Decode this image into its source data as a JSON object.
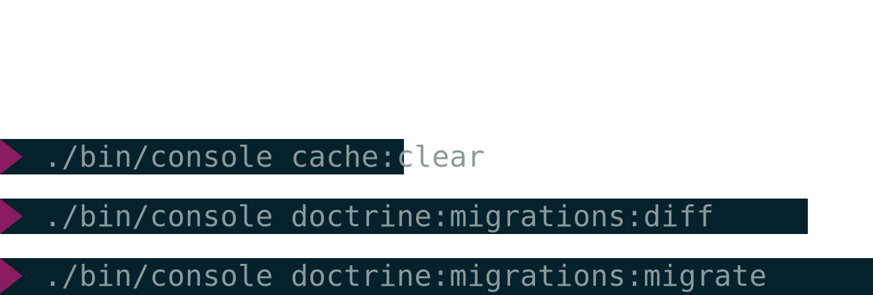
{
  "terminal": {
    "prompt_icon": "chevron-right-icon",
    "prompt_color": "#8b1c62",
    "background_color": "#04212c",
    "text_color": "#8a9a9c",
    "lines": [
      {
        "command": "./bin/console cache:clear"
      },
      {
        "command": "./bin/console doctrine:migrations:diff"
      },
      {
        "command": "./bin/console doctrine:migrations:migrate"
      }
    ]
  }
}
